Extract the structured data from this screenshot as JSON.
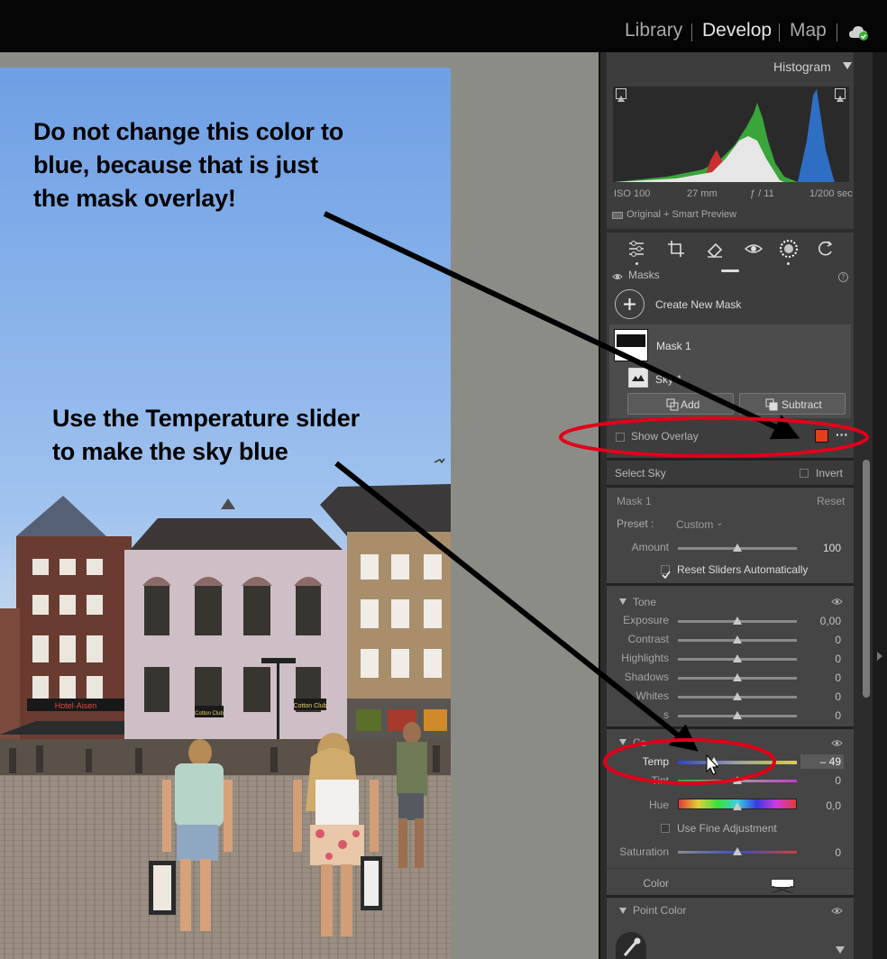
{
  "modules": {
    "library": "Library",
    "develop": "Develop",
    "map": "Map"
  },
  "histogram": {
    "title": "Histogram",
    "iso": "ISO 100",
    "focal": "27 mm",
    "aperture": "ƒ / 11",
    "shutter": "1/200 sec",
    "preview": "Original + Smart Preview"
  },
  "masks": {
    "title": "Masks",
    "create_label": "Create New Mask",
    "mask_name": "Mask 1",
    "component": "Sky 1",
    "add_label": "Add",
    "subtract_label": "Subtract",
    "show_overlay": "Show Overlay",
    "overlay_color": "#e0401a"
  },
  "selection": {
    "title": "Select Sky",
    "invert": "Invert"
  },
  "mask_settings": {
    "mask": "Mask 1",
    "reset": "Reset",
    "preset_label": "Preset :",
    "preset_value": "Custom",
    "amount_label": "Amount",
    "amount_value": "100",
    "amount_level": 0.5,
    "reset_sliders": "Reset Sliders Automatically"
  },
  "tone": {
    "title": "Tone",
    "sliders": [
      {
        "label": "Exposure",
        "value": "0,00"
      },
      {
        "label": "Contrast",
        "value": "0"
      },
      {
        "label": "Highlights",
        "value": "0"
      },
      {
        "label": "Shadows",
        "value": "0"
      },
      {
        "label": "Whites",
        "value": "0"
      },
      {
        "label": "s",
        "value": "0"
      }
    ]
  },
  "color": {
    "title": "Co",
    "temp_label": "Temp",
    "temp_value": "– 49",
    "temp_level": 0.3,
    "tint_label": "Tint",
    "tint_value": "0",
    "hue_label": "Hue",
    "hue_value": "0,0",
    "fine_adjust": "Use Fine Adjustment",
    "saturation_label": "Saturation",
    "saturation_value": "0",
    "color_label": "Color"
  },
  "point_color": {
    "title": "Point Color"
  },
  "annotations": {
    "top_lines": [
      "Do not change this color to",
      "blue, because that is just",
      "the mask overlay!"
    ],
    "bottom_lines": [
      "Use the Temperature slider",
      "to make the sky blue"
    ]
  },
  "shop_signs": {
    "left": "Hotel·Aisen",
    "cafe1": "Cotton Club",
    "cafe2": "Cotton Club"
  },
  "colors": {
    "panel_bg": "#2c2c2c",
    "sub_bg": "#454545",
    "highlight_red": "#e0001a",
    "accent_green": "#35b035"
  }
}
